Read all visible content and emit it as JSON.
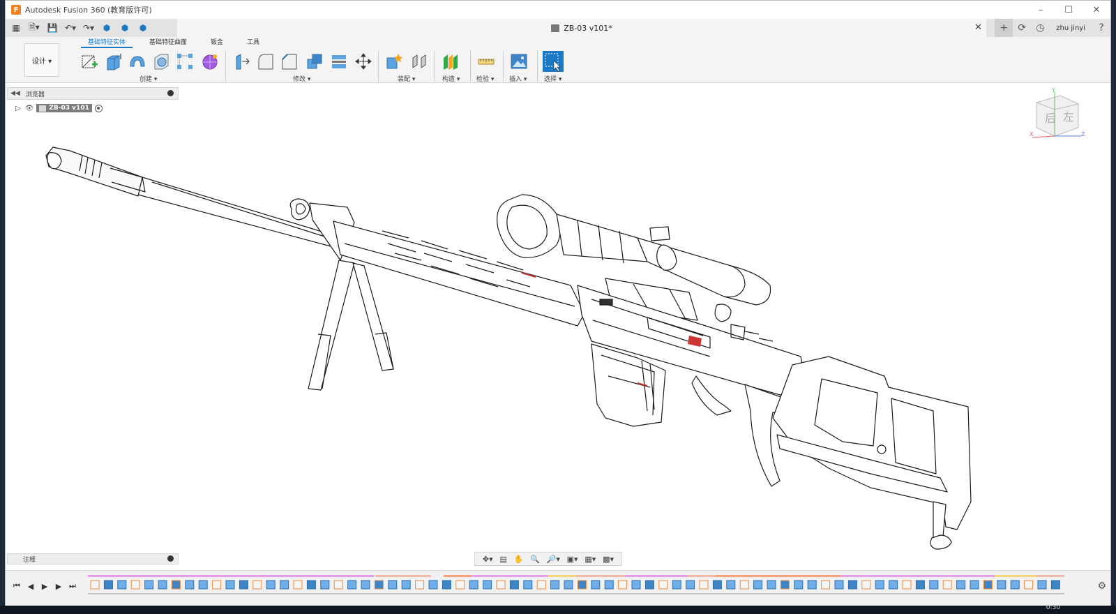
{
  "window": {
    "title": "Autodesk Fusion 360 (教育版许可)",
    "logo_letter": "F"
  },
  "document": {
    "tab_title": "ZB-03 v101*"
  },
  "user": {
    "name": "zhu jinyi"
  },
  "workspace": {
    "label": "设计 ▾"
  },
  "ribbon": {
    "tabs": [
      "基础特征实体",
      "基础特征曲面",
      "钣金",
      "工具"
    ],
    "active_tab": 0,
    "groups": [
      "创建 ▾",
      "修改 ▾",
      "装配 ▾",
      "构造 ▾",
      "检验 ▾",
      "插入 ▾",
      "选择 ▾"
    ],
    "accent": "#1b79c8"
  },
  "browser": {
    "title": "浏览器",
    "root_node": "ZB-03 v101"
  },
  "comments": {
    "title": "注释"
  },
  "viewcube": {
    "faces": [
      "后",
      "左"
    ],
    "axes": [
      "Y",
      "X",
      "Z"
    ]
  },
  "taskbar": {
    "clock": "0:30"
  },
  "icons": {
    "window": [
      "minimize-icon",
      "maximize-icon",
      "close-icon"
    ],
    "nav": [
      "orbit-icon",
      "look-at-icon",
      "pan-icon",
      "zoom-icon",
      "fit-icon",
      "display-icon",
      "grid-icon",
      "viewports-icon"
    ],
    "timeline": [
      "first-icon",
      "prev-icon",
      "play-icon",
      "next-icon",
      "last-icon"
    ]
  }
}
